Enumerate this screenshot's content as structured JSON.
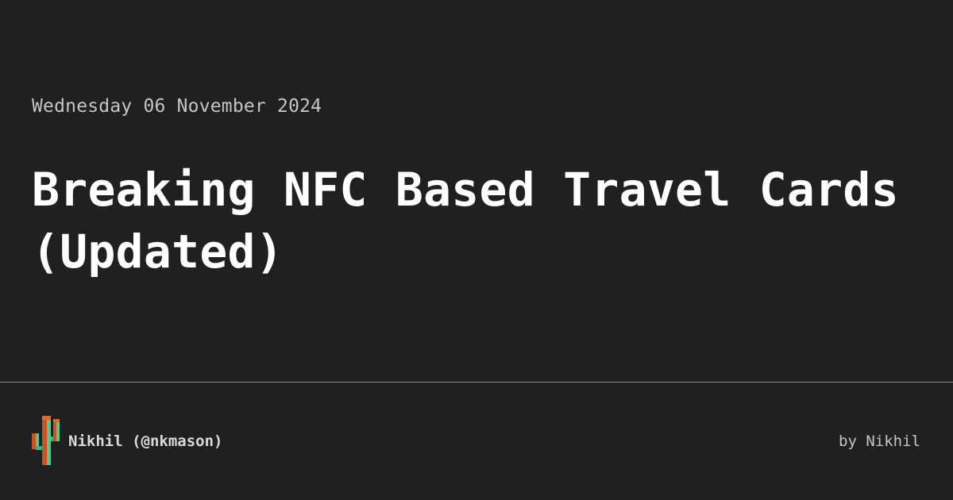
{
  "post": {
    "date": "Wednesday 06 November 2024",
    "title": "Breaking NFC Based Travel Cards (Updated)"
  },
  "footer": {
    "logo_icon": "pixel-cactus-logo-icon",
    "author_handle": "Nikhil (@nkmason)",
    "byline": "by Nikhil"
  },
  "colors": {
    "background": "#1f2022",
    "title": "#ffffff",
    "meta_text": "#c4c5c7",
    "divider": "#48b58a",
    "logo_green": "#4fc990",
    "logo_orange": "#c9541c"
  }
}
